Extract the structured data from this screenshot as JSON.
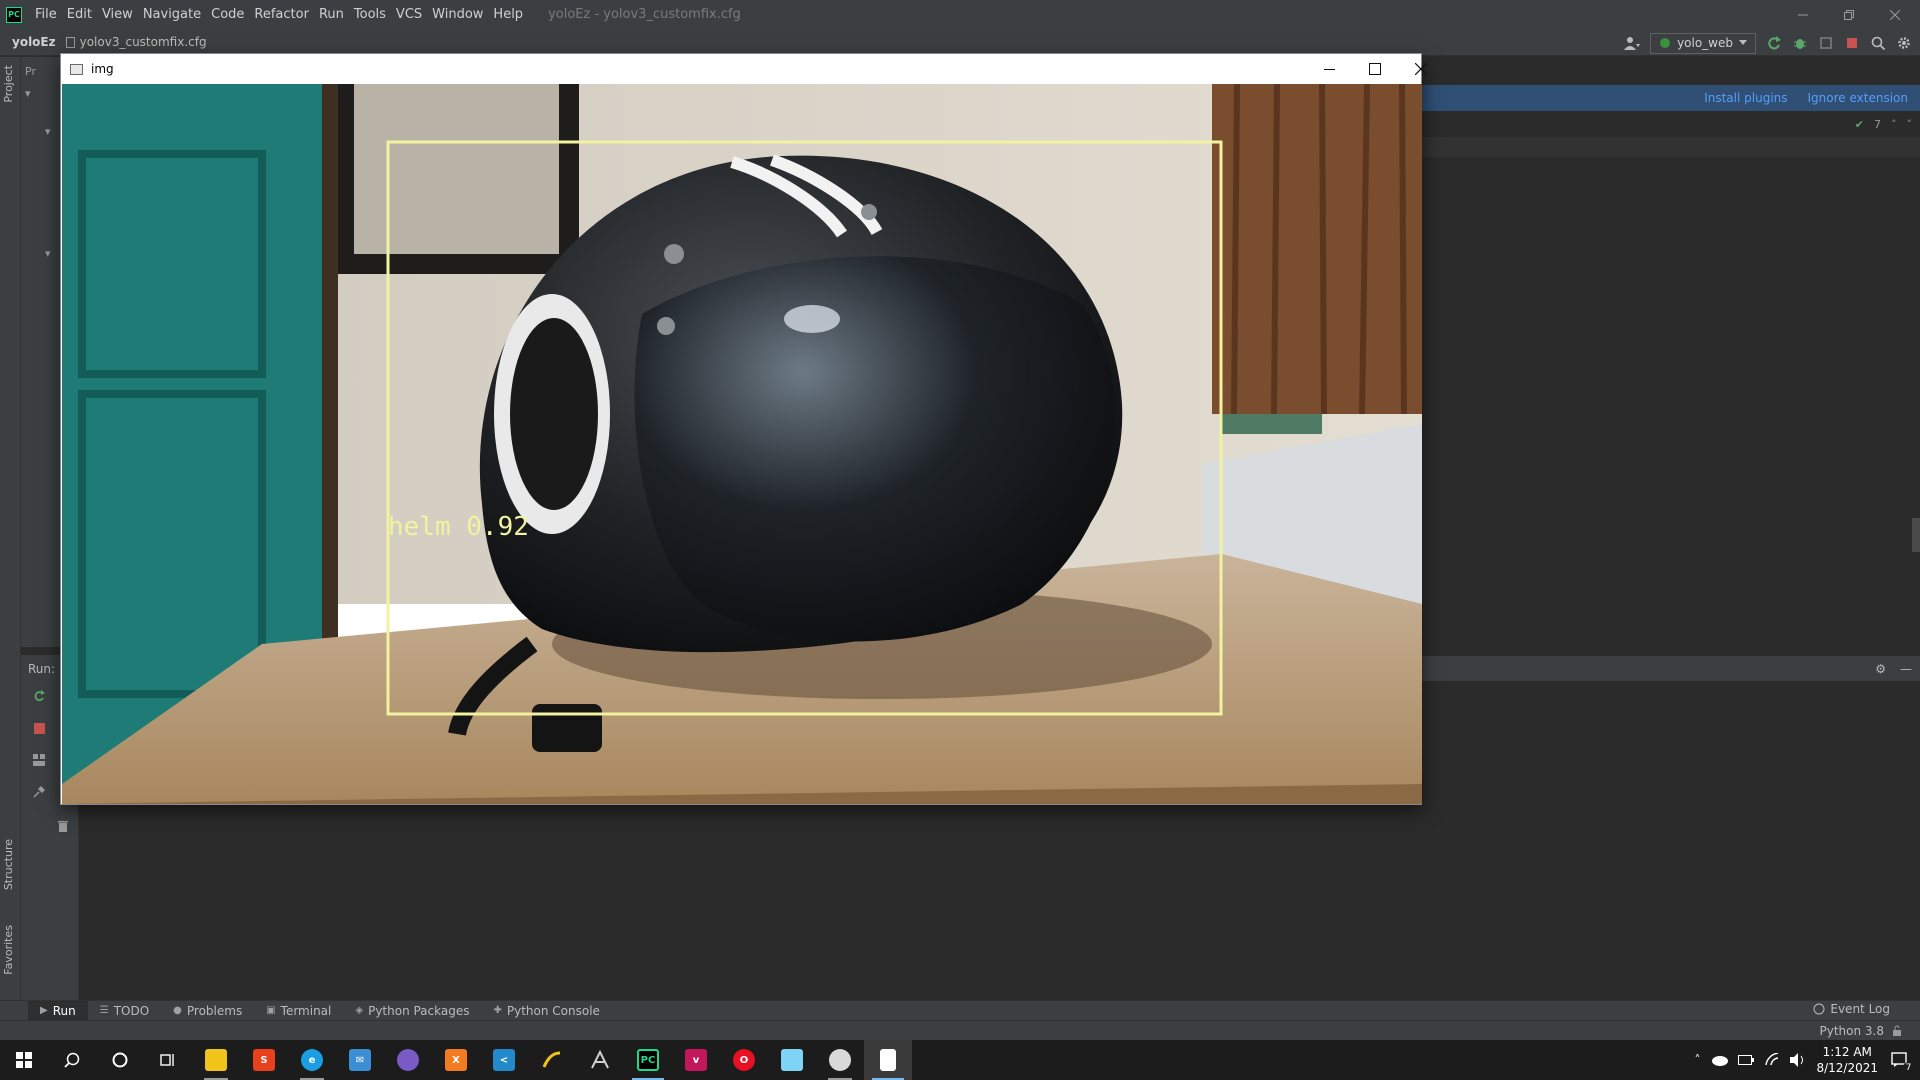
{
  "ide": {
    "menu": [
      "File",
      "Edit",
      "View",
      "Navigate",
      "Code",
      "Refactor",
      "Run",
      "Tools",
      "VCS",
      "Window",
      "Help"
    ],
    "window_title": "yoloEz - yolov3_customfix.cfg",
    "logo_text": "PC",
    "project_name": "yoloEz",
    "file_name": "yolov3_customfix.cfg",
    "run_config": "yolo_web",
    "plugin_banner": {
      "install": "Install plugins",
      "ignore": "Ignore extension"
    },
    "inspection_count": "7",
    "run_label": "Run:",
    "left_stripe": [
      "Project",
      "Structure",
      "Favorites"
    ],
    "project_tab_text": "Pr",
    "tool_tabs": [
      {
        "label": "Run",
        "icon": "play-icon",
        "active": true
      },
      {
        "label": "TODO",
        "icon": "list-icon",
        "active": false
      },
      {
        "label": "Problems",
        "icon": "info-icon",
        "active": false
      },
      {
        "label": "Terminal",
        "icon": "terminal-icon",
        "active": false
      },
      {
        "label": "Python Packages",
        "icon": "packages-icon",
        "active": false
      },
      {
        "label": "Python Console",
        "icon": "python-icon",
        "active": false
      }
    ],
    "event_log": "Event Log",
    "interpreter": "Python 3.8"
  },
  "img_window": {
    "title": "img",
    "detection": {
      "label": "helm 0.92",
      "box_color": "#f2f2a0"
    }
  },
  "taskbar": {
    "time": "1:12 AM",
    "date": "8/12/2021",
    "notification_count": "7",
    "apps": [
      {
        "name": "file-explorer",
        "color": "#f0c419",
        "text": ""
      },
      {
        "name": "sublime",
        "color": "#e8411c",
        "text": "S"
      },
      {
        "name": "edge",
        "color": "#1b9de2",
        "text": "e"
      },
      {
        "name": "mail",
        "color": "#3b8ed4",
        "text": "✉"
      },
      {
        "name": "chrome-canary",
        "color": "#7a5ac4",
        "text": ""
      },
      {
        "name": "xampp",
        "color": "#f47c20",
        "text": "X"
      },
      {
        "name": "vscode",
        "color": "#2489ca",
        "text": "<"
      },
      {
        "name": "anaconda",
        "color": "#1c1c1c",
        "text": ""
      },
      {
        "name": "tool",
        "color": "#1c1c1c",
        "text": ""
      },
      {
        "name": "pycharm",
        "color": "#000000",
        "text": "PC"
      },
      {
        "name": "vysor",
        "color": "#c2185b",
        "text": "v"
      },
      {
        "name": "opera",
        "color": "#e81123",
        "text": "O"
      },
      {
        "name": "notepad",
        "color": "#7fd3f7",
        "text": ""
      },
      {
        "name": "media",
        "color": "#d9d9d9",
        "text": ""
      },
      {
        "name": "document",
        "color": "#ffffff",
        "text": ""
      }
    ]
  }
}
